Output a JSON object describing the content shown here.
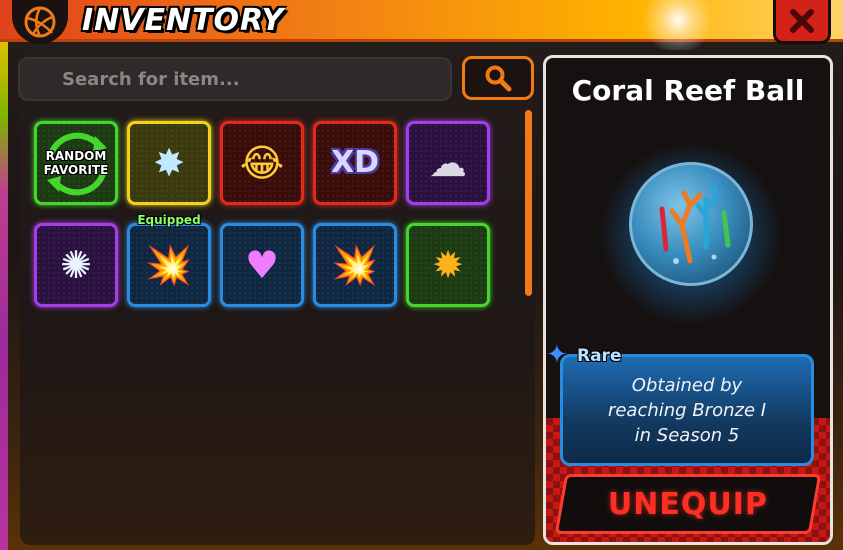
{
  "window": {
    "title": "INVENTORY",
    "close_label": "X"
  },
  "search": {
    "placeholder": "Search for item..."
  },
  "items": [
    {
      "name": "Random Favorite",
      "label_line1": "RANDOM",
      "label_line2": "FAVORITE",
      "border": "#44d62c",
      "bg": "#1d3b12",
      "icon": "random-favorite-icon"
    },
    {
      "name": "Ice Burst",
      "border": "#f2d21b",
      "bg": "#3b3a0e",
      "icon": "ice-burst-icon",
      "glyph": "✸",
      "glyph_color": "#bfe9ff"
    },
    {
      "name": "Laughing Emoji",
      "border": "#e02a1c",
      "bg": "#3a0d0b",
      "icon": "laughing-emoji-icon",
      "glyph": "😂",
      "glyph_color": "#ffcc33"
    },
    {
      "name": "XD",
      "border": "#e02a1c",
      "bg": "#3a0d0b",
      "icon": "xd-icon",
      "glyph": "XD",
      "glyph_color": "#dcd6ff"
    },
    {
      "name": "Storm Cloud",
      "border": "#a63ee8",
      "bg": "#2a1140",
      "icon": "storm-cloud-icon",
      "glyph": "☁",
      "glyph_color": "#d9d9e6"
    },
    {
      "name": "Lightning Orb",
      "border": "#a63ee8",
      "bg": "#2a1140",
      "icon": "lightning-orb-icon",
      "glyph": "✺",
      "glyph_color": "#e8f3ff"
    },
    {
      "name": "Brick Blast",
      "border": "#2b8be0",
      "bg": "#0f2740",
      "icon": "brick-blast-icon",
      "glyph": "💥",
      "glyph_color": "#b5402a",
      "equipped": true
    },
    {
      "name": "Heart",
      "border": "#2b8be0",
      "bg": "#0f2740",
      "icon": "heart-icon",
      "glyph": "♥",
      "glyph_color": "#f07cff"
    },
    {
      "name": "Mushroom Cloud",
      "border": "#2b8be0",
      "bg": "#0f2740",
      "icon": "explosion-icon",
      "glyph": "💥",
      "glyph_color": "#ff8a1c"
    },
    {
      "name": "Fire Burst",
      "border": "#44d62c",
      "bg": "#1d3b12",
      "icon": "fire-burst-icon",
      "glyph": "✹",
      "glyph_color": "#ffb11c"
    }
  ],
  "equipped_tag": "Equipped",
  "detail": {
    "title": "Coral Reef Ball",
    "rarity": "Rare",
    "description_lines": [
      "Obtained by",
      "reaching Bronze I",
      "in Season 5"
    ],
    "button_label": "UNEQUIP"
  },
  "colors": {
    "accent": "#f07a16",
    "rare": "#2b8be0",
    "unequip": "#ff2e22"
  }
}
